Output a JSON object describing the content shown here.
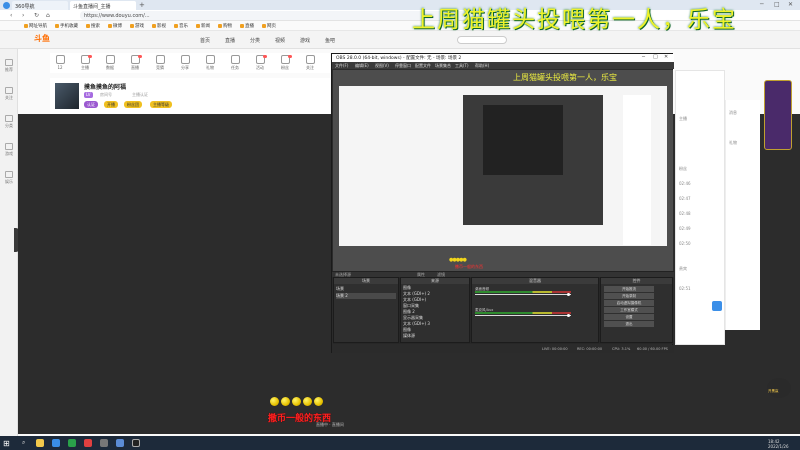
{
  "browser": {
    "tabs": [
      "360导航",
      "斗鱼直播间_主播"
    ],
    "new_tab": "+",
    "window_controls": [
      "─",
      "□",
      "✕"
    ],
    "nav": [
      "‹",
      "›",
      "↻",
      "⌂"
    ],
    "url": "https://www.douyu.com/...",
    "bookmarks": [
      "网址导航",
      "手机收藏",
      "搜索",
      "微博",
      "游戏",
      "影视",
      "音乐",
      "新闻",
      "购物",
      "直播",
      "网页"
    ]
  },
  "overlay_title": "上周猫罐头投喂第一人，乐宝",
  "site": {
    "logo": "斗鱼",
    "nav": [
      "首页",
      "直播",
      "分类",
      "视频",
      "游戏",
      "鱼吧"
    ],
    "icon_row": [
      "12",
      "主播",
      "数据",
      "直播",
      "竞猜",
      "分享",
      "礼物",
      "任务",
      "活动",
      "粉丝",
      "关注"
    ],
    "room_title": "摸鱼摸鱼的阿福",
    "tags": [
      "LV",
      "房间号",
      "主播认证"
    ],
    "chips": [
      "认证",
      "开播",
      "粉丝团",
      "主播等级"
    ],
    "video_label": "直播中 · 直播间"
  },
  "rail": [
    "推荐",
    "关注",
    "分类",
    "游戏",
    "娱乐"
  ],
  "right_col": [
    "主播",
    "粉丝",
    "贵宾",
    "消息",
    "礼物"
  ],
  "right_col_list": [
    "02:46",
    "02:47",
    "02:48",
    "02:49",
    "02:50",
    "02:51"
  ],
  "float_label": "开黑赢",
  "obs": {
    "title": "OBS 28.0.0 (64-bit, windows) - 配置文件: 无 - 场景: 场景 2",
    "window_controls": [
      "─",
      "□",
      "✕"
    ],
    "menu": [
      "文件(F)",
      "编辑(E)",
      "视图(V)",
      "停靠窗口",
      "配置文件",
      "场景集合",
      "工具(T)",
      "帮助(H)"
    ],
    "preview_title": "上周猫罐头投喂第一人，乐宝",
    "preview_coins": "●●●●●",
    "preview_caption": "撒币一般的东西",
    "preview_bar": [
      "未选择源",
      "属性",
      "滤镜"
    ],
    "docks": {
      "scenes": "场景",
      "sources": "来源",
      "mixer": "混音器",
      "transitions": "场景过渡",
      "controls": "控件"
    },
    "scene_items": [
      "场景",
      "场景 2"
    ],
    "source_items": [
      "图像",
      "文本 (GDI+) 2",
      "文本 (GDI+)",
      "窗口采集",
      "图像 2",
      "显示器采集",
      "文本 (GDI+) 3",
      "图像",
      "媒体源"
    ],
    "mixer_items": [
      "桌面音频",
      "麦克风/Aux"
    ],
    "transition_items": [
      "渐变",
      "时长 300 ms"
    ],
    "control_buttons": [
      "开始推流",
      "开始录制",
      "启动虚拟摄像机",
      "工作室模式",
      "设置",
      "退出"
    ],
    "status": [
      "LIVE: 00:00:00",
      "REC: 00:00:00",
      "CPU: 3.1%",
      "60.00 / 60.00 FPS"
    ]
  },
  "bottom_caption": "撒币一般的东西",
  "taskbar": {
    "start": "⊞",
    "search": "⌕",
    "tray_time": "18:42",
    "tray_date": "2022/1/26"
  }
}
